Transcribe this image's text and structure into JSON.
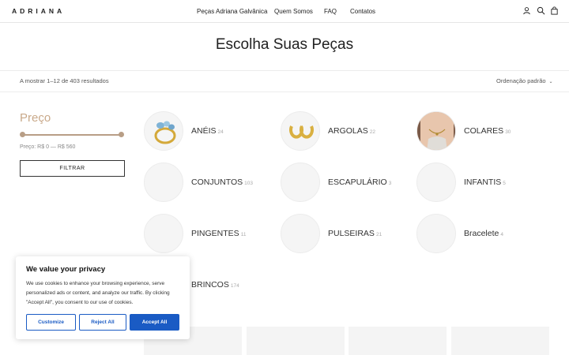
{
  "header": {
    "logo": "ADRIANA",
    "nav": [
      "Peças Adriana Galvânica",
      "Quem Somos",
      "FAQ",
      "Contatos"
    ],
    "icons": [
      "user-icon",
      "search-icon",
      "cart-icon"
    ]
  },
  "page": {
    "title": "Escolha Suas Peças",
    "result_count": "A mostrar 1–12 de 403 resultados",
    "ordering": "Ordenação padrão"
  },
  "filter": {
    "title": "Preço",
    "range": "Preço: R$ 0 — R$ 560",
    "button": "FILTRAR",
    "accent_color": "#c9a98a"
  },
  "categories": [
    {
      "name": "ANÉIS",
      "count": "24"
    },
    {
      "name": "ARGOLAS",
      "count": "22"
    },
    {
      "name": "COLARES",
      "count": "30"
    },
    {
      "name": "CONJUNTOS",
      "count": "103"
    },
    {
      "name": "ESCAPULÁRIO",
      "count": "3"
    },
    {
      "name": "INFANTIS",
      "count": "5"
    },
    {
      "name": "PINGENTES",
      "count": "11"
    },
    {
      "name": "PULSEIRAS",
      "count": "21"
    },
    {
      "name": "Bracelete",
      "count": "4"
    },
    {
      "name": "BRINCOS",
      "count": "174"
    }
  ],
  "cookie": {
    "title": "We value your privacy",
    "text": "We use cookies to enhance your browsing experience, serve personalized ads or content, and analyze our traffic. By clicking \"Accept All\", you consent to our use of cookies.",
    "customize": "Customize",
    "reject": "Reject All",
    "accept": "Accept All",
    "accent_color": "#1a5bc4"
  }
}
